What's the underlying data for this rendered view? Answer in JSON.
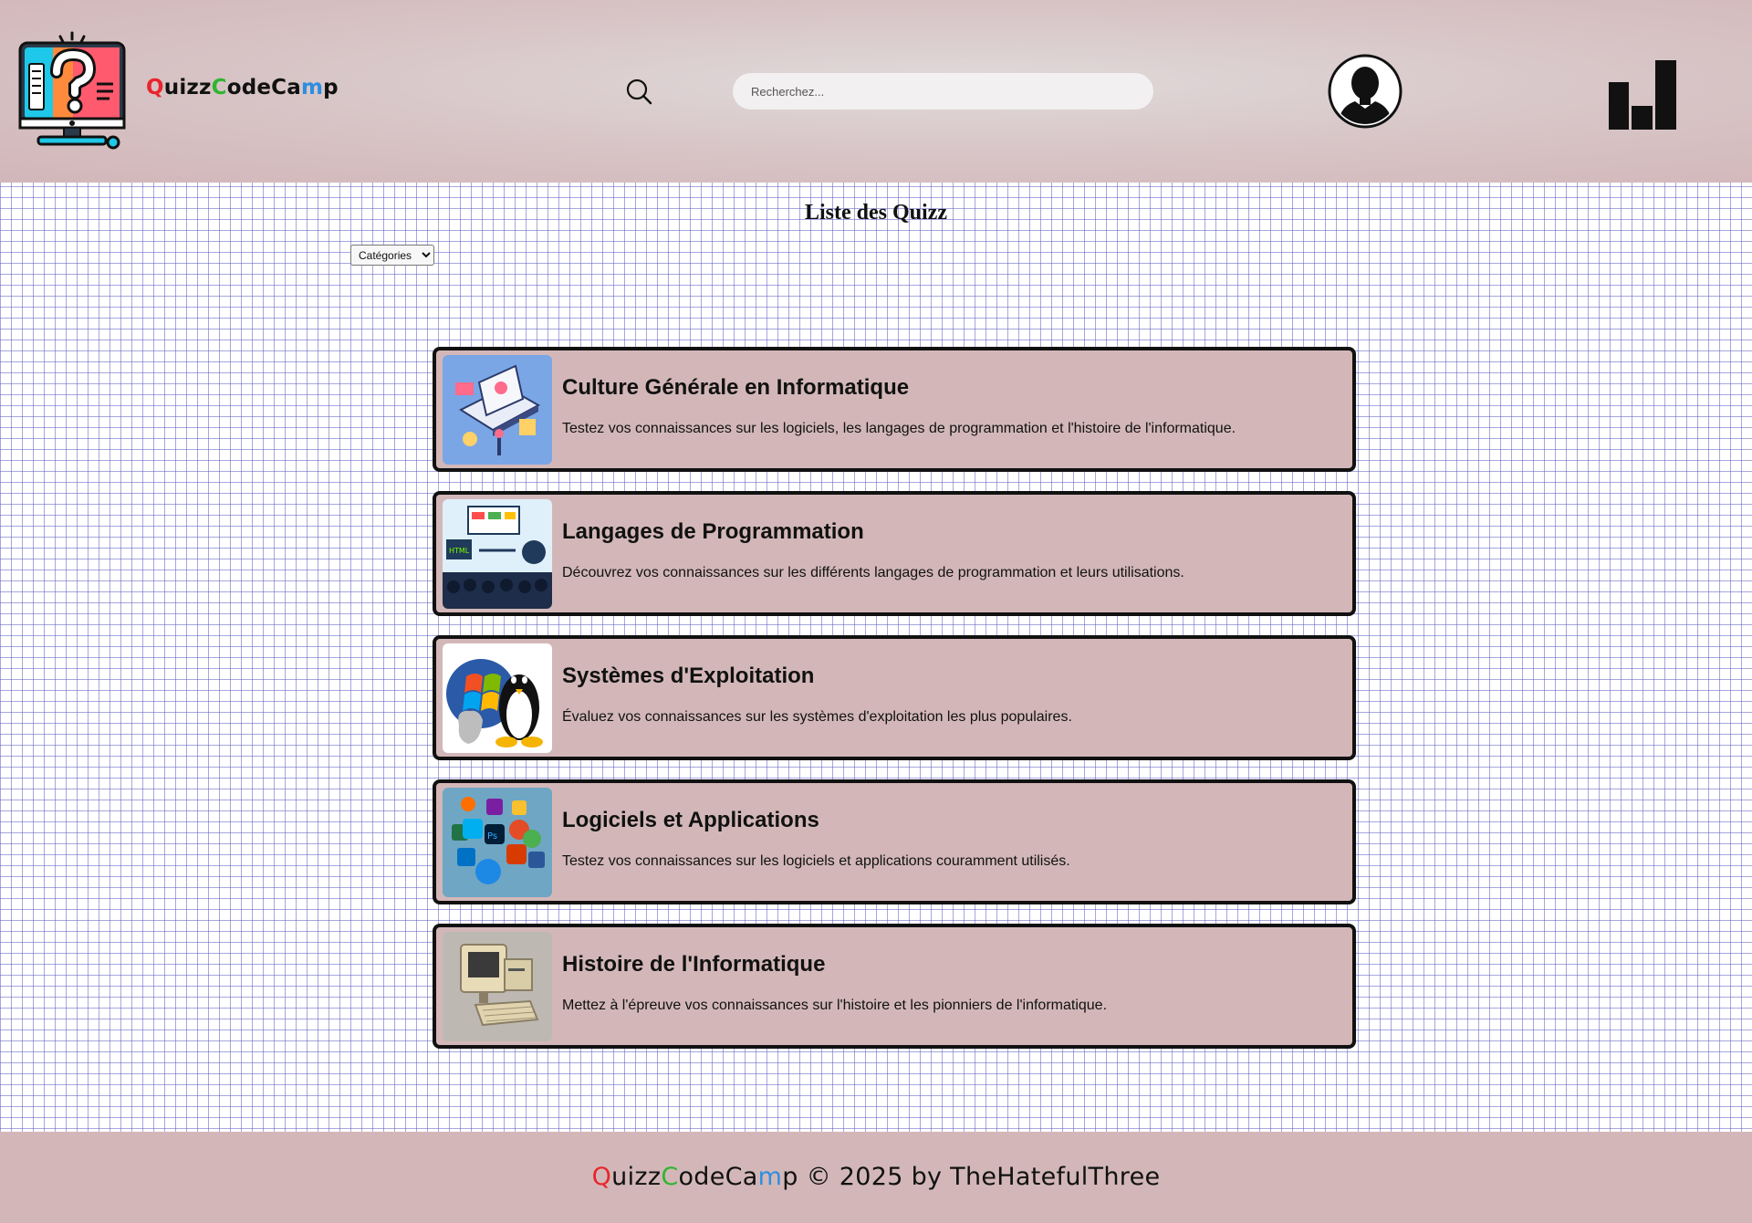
{
  "header": {
    "brand": {
      "q": "Q",
      "uizz": "uizz",
      "c": "C",
      "odeca": "odeCa",
      "m": "m",
      "p": "p"
    },
    "search_placeholder": "Recherchez..."
  },
  "main": {
    "title": "Liste des Quizz",
    "category_select": {
      "selected": "Catégories",
      "options": [
        "Catégories"
      ]
    },
    "quizzes": [
      {
        "title": "Culture Générale en Informatique",
        "description": "Testez vos connaissances sur les logiciels, les langages de programmation et l'histoire de l'informatique.",
        "icon": "laptop-illustration-icon"
      },
      {
        "title": "Langages de Programmation",
        "description": "Découvrez vos connaissances sur les différents langages de programmation et leurs utilisations.",
        "icon": "programming-languages-icon"
      },
      {
        "title": "Systèmes d'Exploitation",
        "description": "Évaluez vos connaissances sur les systèmes d'exploitation les plus populaires.",
        "icon": "operating-systems-icon"
      },
      {
        "title": "Logiciels et Applications",
        "description": "Testez vos connaissances sur les logiciels et applications couramment utilisés.",
        "icon": "software-apps-icon"
      },
      {
        "title": "Histoire de l'Informatique",
        "description": "Mettez à l'épreuve vos connaissances sur l'histoire et les pionniers de l'informatique.",
        "icon": "retro-computer-icon"
      }
    ]
  },
  "footer": {
    "brand": {
      "q": "Q",
      "uizz": "uizz",
      "c": "C",
      "odeca": "odeCa",
      "m": "m",
      "p": "p"
    },
    "suffix": " © 2025 by TheHatefulThree"
  },
  "colors": {
    "header_bg": "#d7c3c5",
    "card_bg": "#d3b7b8",
    "footer_bg": "#d3b7b8",
    "brand_red": "#e8262c",
    "brand_green": "#2fb531",
    "brand_blue": "#2d8ee0"
  }
}
